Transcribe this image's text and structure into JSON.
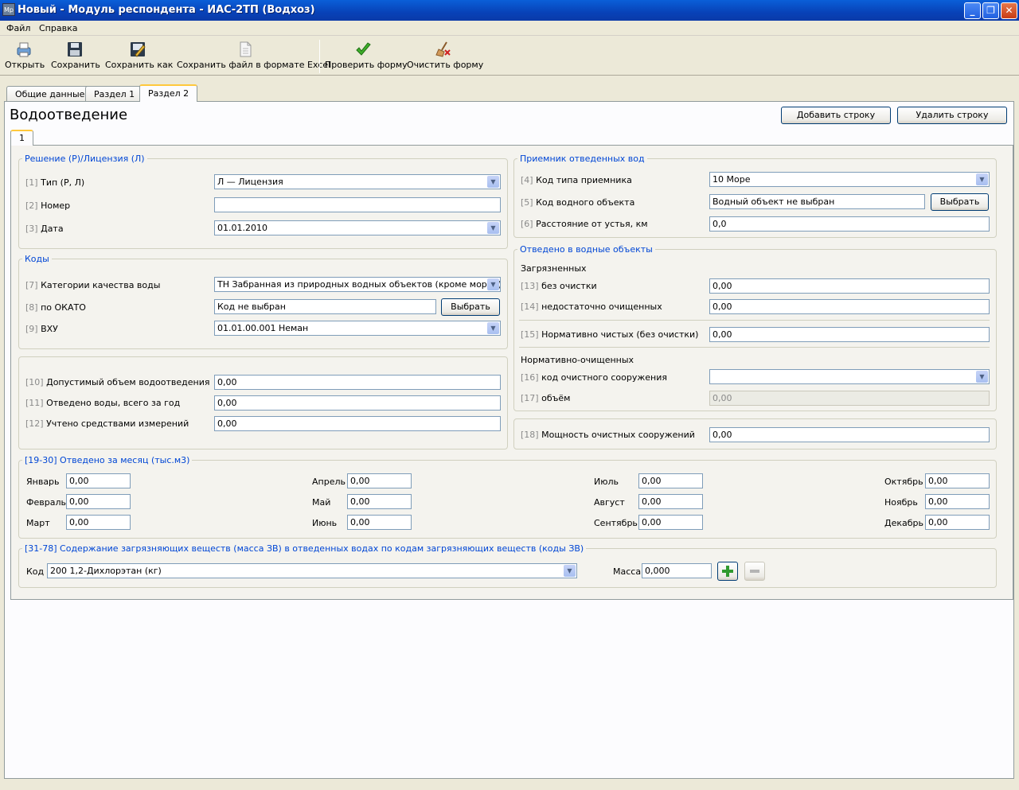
{
  "window": {
    "icon_text": "Мр",
    "title": "Новый - Модуль респондента - ИАС-2ТП (Водхоз)"
  },
  "menu": [
    "Файл",
    "Справка"
  ],
  "toolbar": {
    "open": "Открыть",
    "save": "Сохранить",
    "save_as": "Сохранить как",
    "save_excel": "Сохранить файл в формате Excel",
    "check": "Проверить форму",
    "clear": "Очистить форму"
  },
  "tabs": [
    "Общие данные",
    "Раздел 1",
    "Раздел 2"
  ],
  "page_title": "Водоотведение",
  "buttons": {
    "add_row": "Добавить строку",
    "delete_row": "Удалить строку",
    "choose": "Выбрать"
  },
  "inner_tab": "1",
  "decision": {
    "title": "Решение (Р)/Лицензия (Л)",
    "f1": {
      "num": "[1]",
      "label": "Тип (Р, Л)",
      "value": "Л — Лицензия"
    },
    "f2": {
      "num": "[2]",
      "label": "Номер",
      "value": ""
    },
    "f3": {
      "num": "[3]",
      "label": "Дата",
      "value": "01.01.2010"
    }
  },
  "codes": {
    "title": "Коды",
    "f7": {
      "num": "[7]",
      "label": "Категории качества воды",
      "value": "ТН Забранная из природных водных объектов (кроме морей)"
    },
    "f8": {
      "num": "[8]",
      "label": "по ОКАТО",
      "value": "Код не выбран"
    },
    "f9": {
      "num": "[9]",
      "label": "ВХУ",
      "value": "01.01.00.001 Неман"
    }
  },
  "volumes": {
    "f10": {
      "num": "[10]",
      "label": "Допустимый объем водоотведения",
      "value": "0,00"
    },
    "f11": {
      "num": "[11]",
      "label": "Отведено воды, всего за год",
      "value": "0,00"
    },
    "f12": {
      "num": "[12]",
      "label": "Учтено средствами измерений",
      "value": "0,00"
    }
  },
  "receiver": {
    "title": "Приемник отведенных вод",
    "f4": {
      "num": "[4]",
      "label": "Код типа приемника",
      "value": "10 Море"
    },
    "f5": {
      "num": "[5]",
      "label": "Код водного объекта",
      "value": "Водный объект не выбран"
    },
    "f6": {
      "num": "[6]",
      "label": "Расстояние от устья, км",
      "value": "0,0"
    }
  },
  "discharged": {
    "title": "Отведено в водные объекты",
    "polluted": "Загрязненных",
    "f13": {
      "num": "[13]",
      "label": "без очистки",
      "value": "0,00"
    },
    "f14": {
      "num": "[14]",
      "label": "недостаточно очищенных",
      "value": "0,00"
    },
    "f15": {
      "num": "[15]",
      "label": "Нормативно чистых (без очистки)",
      "value": "0,00"
    },
    "normative": "Нормативно-очищенных",
    "f16": {
      "num": "[16]",
      "label": "код очистного сооружения",
      "value": ""
    },
    "f17": {
      "num": "[17]",
      "label": "объём",
      "value": "0,00"
    }
  },
  "capacity": {
    "num": "[18]",
    "label": "Мощность очистных сооружений",
    "value": "0,00"
  },
  "monthly": {
    "title": "[19-30] Отведено за месяц (тыс.м3)",
    "months": [
      {
        "label": "Январь",
        "value": "0,00"
      },
      {
        "label": "Февраль",
        "value": "0,00"
      },
      {
        "label": "Март",
        "value": "0,00"
      },
      {
        "label": "Апрель",
        "value": "0,00"
      },
      {
        "label": "Май",
        "value": "0,00"
      },
      {
        "label": "Июнь",
        "value": "0,00"
      },
      {
        "label": "Июль",
        "value": "0,00"
      },
      {
        "label": "Август",
        "value": "0,00"
      },
      {
        "label": "Сентябрь",
        "value": "0,00"
      },
      {
        "label": "Октябрь",
        "value": "0,00"
      },
      {
        "label": "Ноябрь",
        "value": "0,00"
      },
      {
        "label": "Декабрь",
        "value": "0,00"
      }
    ]
  },
  "pollutants": {
    "title": "[31-78] Содержание загрязняющих веществ (масса ЗВ) в отведенных водах по кодам загрязняющих веществ (коды ЗВ)",
    "code_label": "Код",
    "code_value": "200 1,2-Дихлорэтан (кг)",
    "mass_label": "Масса",
    "mass_value": "0,000"
  },
  "colors": {
    "title_bar": "#0a5fd8",
    "group_title": "#0046d5",
    "tab_accent": "#ffc83c"
  }
}
